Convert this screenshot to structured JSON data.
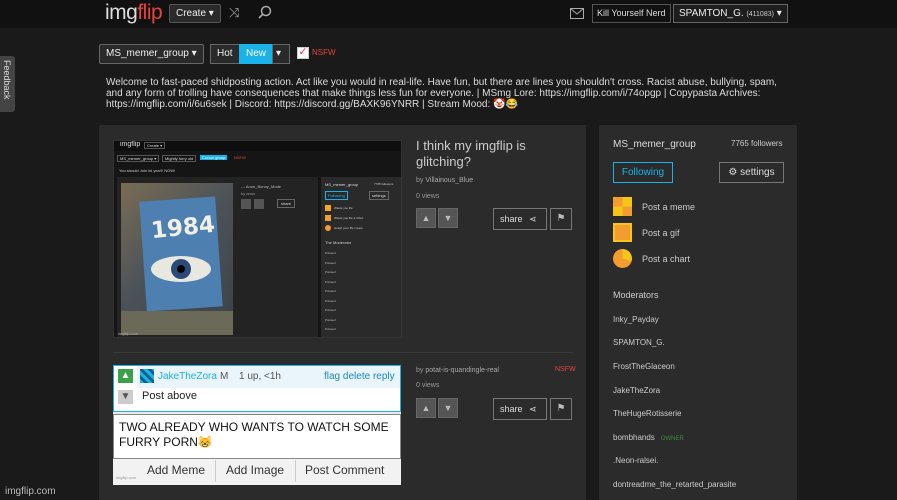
{
  "header": {
    "logo_a": "img",
    "logo_b": "flip",
    "create_label": "Create ▾",
    "flair": "Kill Yourself Nerd",
    "username": "SPAMTON_G.",
    "points": "(411083)",
    "user_caret": "▾"
  },
  "feedback_label": "Feedback",
  "stream_bar": {
    "stream_select": "MS_memer_group ▾",
    "sort_hot": "Hot",
    "sort_new": "New",
    "sort_caret": "▾",
    "nsfw_label": "NSFW"
  },
  "description": "Welcome to fast-paced shidposting action. Act like you would in real-life. Have fun, but there are lines you shouldn't cross. Racist abuse, bullying, spam, and any form of trolling have consequences that make things less fun for everyone. | MSmg Lore: https://imgflip.com/i/74opgp | Copypasta Archives: https://imgflip.com/i/6u6sek | Discord: https://discord.gg/BAXK96YNRR | Stream Mood: 🤡😂",
  "posts": [
    {
      "title": "I think my imgflip is glitching?",
      "by_prefix": "by",
      "author": "Villainous_Blue",
      "views": "0 views",
      "share_label": "share",
      "thumb": {
        "logo": "imgflip",
        "create": "Create ▾",
        "group": "MS_memer_group ▾",
        "sort": "Mightly furry old",
        "sort_active": "Cursor group",
        "nsfw": "NSFW",
        "stream_line": "You should Join lol yea!!! NOW!",
        "side_group": "MS_memer_group",
        "side_followers": "7765 followers",
        "side_following": "Following",
        "side_settings": "settings",
        "side_actions": [
          "Waste you life",
          "Waste you life a video",
          "Graph your life meets"
        ],
        "side_mods_title": "The Moderator",
        "side_mods": [
          "Poissed",
          "Poissed",
          "Poissed",
          "Poissed",
          "Poissed",
          "Poissed",
          "Poissed",
          "Poissed",
          "Poissed"
        ],
        "art_text": "1984",
        "caption_author": "— Anon_Bunny_Mode",
        "caption_by": "by anon",
        "share": "share",
        "watermark": "imgflip.com"
      }
    },
    {
      "by_prefix": "by",
      "author": "potat-is-quandingle-real",
      "nsfw_tag": "NSFW",
      "views": "0 views",
      "share_label": "share",
      "thumb": {
        "commenter": "JakeTheZora",
        "badge": "M",
        "meta": "1 up, <1h",
        "flag": "flag",
        "delete": "delete",
        "reply": "reply",
        "comment_text": "Post above",
        "meme_text": "TWO ALREADY WHO WANTS TO WATCH SOME FURRY PORN😸",
        "add_meme": "Add Meme",
        "add_image": "Add Image",
        "post_comment": "Post Comment",
        "watermark": "imgflip.com"
      }
    }
  ],
  "sidebar": {
    "group": "MS_memer_group",
    "followers": "7765 followers",
    "following": "Following",
    "settings": "settings",
    "actions": [
      {
        "label": "Post a meme",
        "icon": "meme-icon"
      },
      {
        "label": "Post a gif",
        "icon": "gif-icon"
      },
      {
        "label": "Post a chart",
        "icon": "chart-icon"
      }
    ],
    "moderators_title": "Moderators",
    "moderators": [
      "Inky_Payday",
      "SPAMTON_G.",
      "FrostTheGlaceon",
      "JakeTheZora",
      "TheHugeRotisserie",
      "bombhands",
      ".Neon-ralsei.",
      "dontreadme_the_retarted_parasite"
    ],
    "owner_tag": "OWNER"
  },
  "watermark": "imgflip.com",
  "colors": {
    "accent": "#1ab2e8",
    "logo_red": "#e8423d",
    "owner": "#3a8f3a"
  }
}
